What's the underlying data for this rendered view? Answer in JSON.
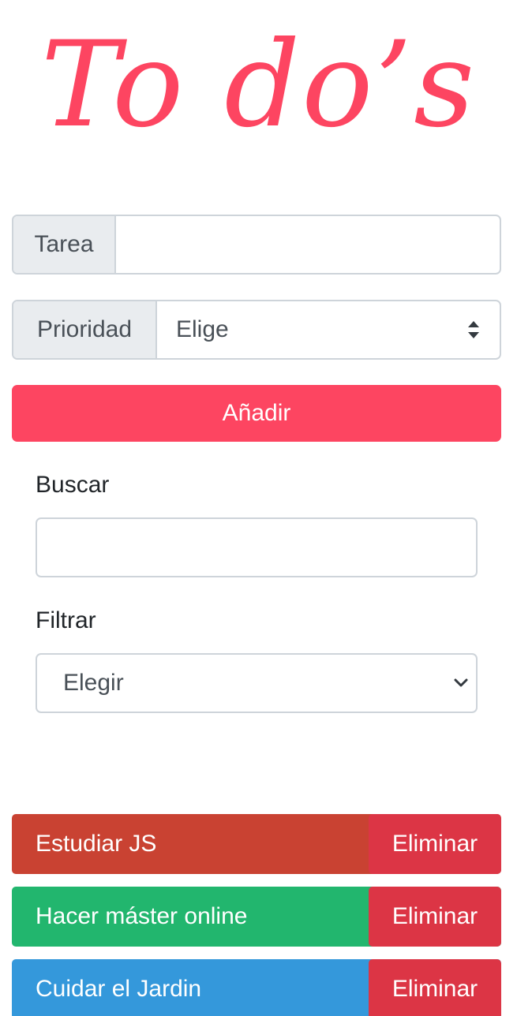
{
  "header": {
    "title": "To do’s"
  },
  "form": {
    "task_label": "Tarea",
    "task_value": "",
    "priority_label": "Prioridad",
    "priority_selected": "Elige",
    "add_button_label": "Añadir"
  },
  "search": {
    "label": "Buscar",
    "value": ""
  },
  "filter": {
    "label": "Filtrar",
    "selected": "Elegir"
  },
  "todos": [
    {
      "text": "Estudiar JS",
      "delete_label": "Eliminar",
      "color": "#c94232"
    },
    {
      "text": "Hacer máster online",
      "delete_label": "Eliminar",
      "color": "#22b66e"
    },
    {
      "text": "Cuidar el Jardin",
      "delete_label": "Eliminar",
      "color": "#3498db"
    }
  ],
  "colors": {
    "accent": "#fd4561",
    "danger": "#dc3545",
    "border": "#ced4da",
    "addon_bg": "#e9ecef"
  },
  "icons": {
    "priority_select": "sort-arrows-icon",
    "filter_select": "chevron-down-icon"
  }
}
